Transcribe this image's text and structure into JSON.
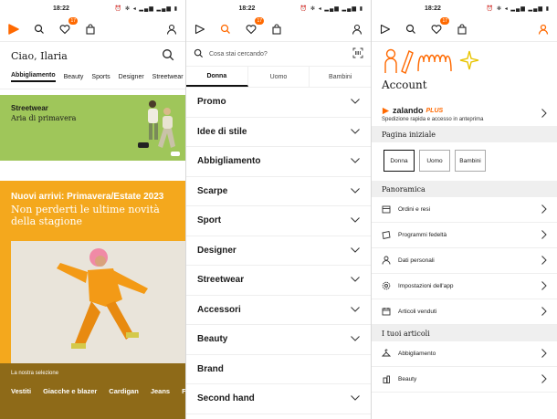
{
  "status": {
    "time": "18:22",
    "icons": "⏰ ✻ ◂ ▂▄▆ ▂▄▆ ▮"
  },
  "nav": {
    "badge": "17"
  },
  "home": {
    "greeting": "Ciao, Ilaria",
    "tabs": [
      "Abbigliamento",
      "Beauty",
      "Sports",
      "Designer",
      "Streetwear"
    ],
    "banner": {
      "title": "Streetwear",
      "subtitle": "Aria di primavera"
    },
    "promo": {
      "title": "Nuovi arrivi: Primavera/Estate 2023",
      "subtitle": "Non perderti le ultime novità della stagione"
    },
    "selection": {
      "label": "La nostra selezione",
      "items": [
        "Vestiti",
        "Giacche e blazer",
        "Cardigan",
        "Jeans",
        "F"
      ]
    }
  },
  "browse": {
    "search_placeholder": "Cosa stai cercando?",
    "gender_tabs": [
      "Donna",
      "Uomo",
      "Bambini"
    ],
    "categories": [
      "Promo",
      "Idee di stile",
      "Abbigliamento",
      "Scarpe",
      "Sport",
      "Designer",
      "Streetwear",
      "Accessori",
      "Beauty",
      "Brand",
      "Second hand"
    ]
  },
  "account": {
    "title": "Account",
    "plus_brand": "zalando",
    "plus_label": "PLUS",
    "plus_sub": "Spedizione rapida e accesso in anteprima",
    "home_section": "Pagina iniziale",
    "gender_buttons": [
      "Donna",
      "Uomo",
      "Bambini"
    ],
    "overview_section": "Panoramica",
    "overview_items": [
      "Ordini e resi",
      "Programmi fedeltà",
      "Dati personali",
      "Impostazioni dell'app",
      "Articoli venduti"
    ],
    "articles_section": "I tuoi articoli",
    "article_items": [
      "Abbigliamento",
      "Beauty"
    ]
  },
  "colors": {
    "brand": "#ff6900",
    "green": "#9fc65a",
    "yellow": "#f4a81d",
    "brown": "#8e6a18"
  }
}
